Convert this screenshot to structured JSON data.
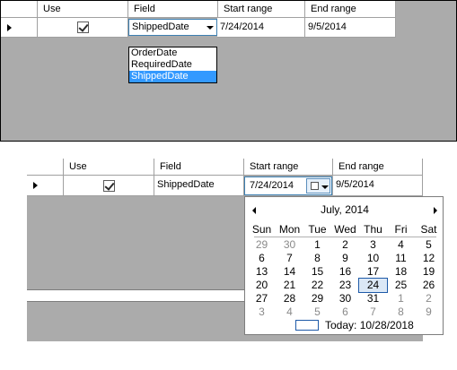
{
  "grid_top": {
    "headers": [
      "Use",
      "Field",
      "Start range",
      "End range"
    ],
    "row": {
      "use_checked": true,
      "field": "ShippedDate",
      "start": "7/24/2014",
      "end": "9/5/2014"
    },
    "dropdown_options": [
      "OrderDate",
      "RequiredDate",
      "ShippedDate"
    ],
    "dropdown_selected": "ShippedDate"
  },
  "grid_bottom": {
    "headers": [
      "Use",
      "Field",
      "Start range",
      "End range"
    ],
    "row": {
      "use_checked": true,
      "field": "ShippedDate",
      "start": "7/24/2014",
      "end": "9/5/2014"
    }
  },
  "calendar": {
    "month_title": "July, 2014",
    "day_names": [
      "Sun",
      "Mon",
      "Tue",
      "Wed",
      "Thu",
      "Fri",
      "Sat"
    ],
    "weeks": [
      [
        "29",
        "30",
        "1",
        "2",
        "3",
        "4",
        "5"
      ],
      [
        "6",
        "7",
        "8",
        "9",
        "10",
        "11",
        "12"
      ],
      [
        "13",
        "14",
        "15",
        "16",
        "17",
        "18",
        "19"
      ],
      [
        "20",
        "21",
        "22",
        "23",
        "24",
        "25",
        "26"
      ],
      [
        "27",
        "28",
        "29",
        "30",
        "31",
        "1",
        "2"
      ],
      [
        "3",
        "4",
        "5",
        "6",
        "7",
        "8",
        "9"
      ]
    ],
    "selected_day": "24",
    "today_label": "Today: 10/28/2018"
  },
  "colors": {
    "grid_bg": "#ababab",
    "selection_blue": "#3399ff",
    "focus_border": "#3c7fb1"
  }
}
